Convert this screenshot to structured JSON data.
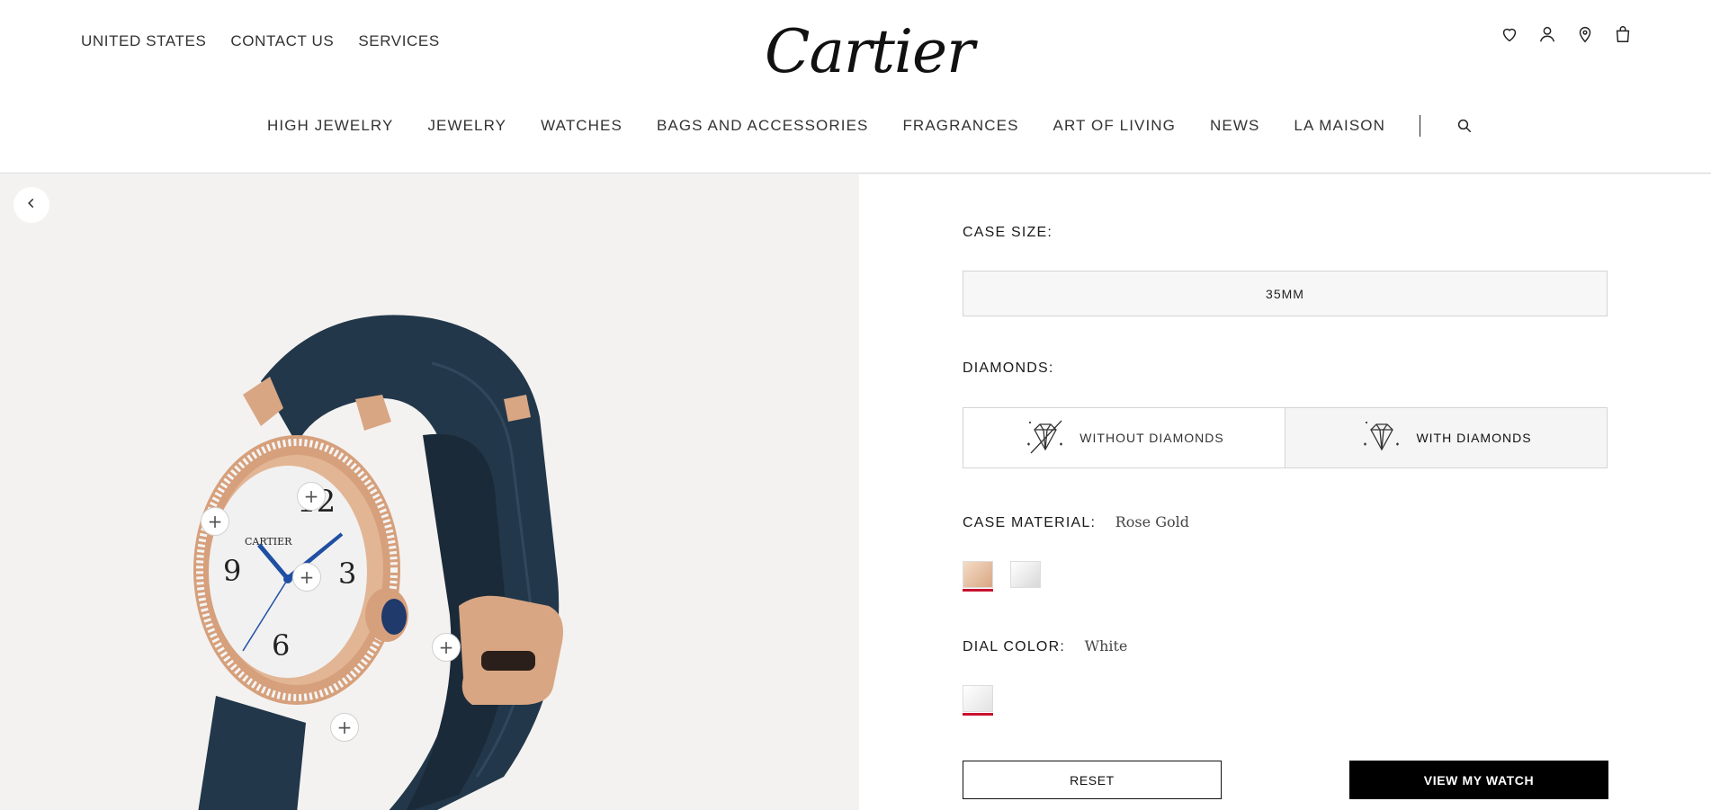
{
  "header": {
    "utility_links": [
      "UNITED STATES",
      "CONTACT US",
      "SERVICES"
    ],
    "logo_text": "Cartier",
    "icons": [
      "heart-icon",
      "user-icon",
      "location-pin-icon",
      "shopping-bag-icon"
    ],
    "nav_items": [
      "HIGH JEWELRY",
      "JEWELRY",
      "WATCHES",
      "BAGS AND ACCESSORIES",
      "FRAGRANCES",
      "ART OF LIVING",
      "NEWS",
      "LA MAISON"
    ]
  },
  "product_view": {
    "back_icon": "chevron-left-icon",
    "hotspot_symbol": "+",
    "hotspot_count": 6,
    "dial_numerals": [
      "12",
      "3",
      "6",
      "9"
    ],
    "dial_brand": "CARTIER"
  },
  "configurator": {
    "case_size": {
      "label": "CASE SIZE:",
      "option": "35MM"
    },
    "diamonds": {
      "label": "DIAMONDS:",
      "options": [
        {
          "label": "WITHOUT DIAMONDS",
          "selected": false,
          "icon": "diamond-crossed-icon"
        },
        {
          "label": "WITH DIAMONDS",
          "selected": true,
          "icon": "diamond-sparkle-icon"
        }
      ]
    },
    "case_material": {
      "label": "CASE MATERIAL:",
      "value": "Rose Gold",
      "swatches": [
        {
          "name": "rose-gold",
          "color": "#e8c5a6",
          "selected": true
        },
        {
          "name": "steel",
          "color": "#e6e6e6",
          "selected": false
        }
      ]
    },
    "dial_color": {
      "label": "DIAL COLOR:",
      "value": "White",
      "swatches": [
        {
          "name": "white",
          "color": "#f3f3f3",
          "selected": true
        }
      ]
    },
    "buttons": {
      "reset": "RESET",
      "view": "VIEW MY WATCH"
    }
  },
  "colors": {
    "accent_red": "#c8102e",
    "panel_bg": "#f4f2f1",
    "strap_navy": "#1f2f3f",
    "rose_gold": "#d9a683",
    "hand_blue": "#1f4fa3"
  }
}
